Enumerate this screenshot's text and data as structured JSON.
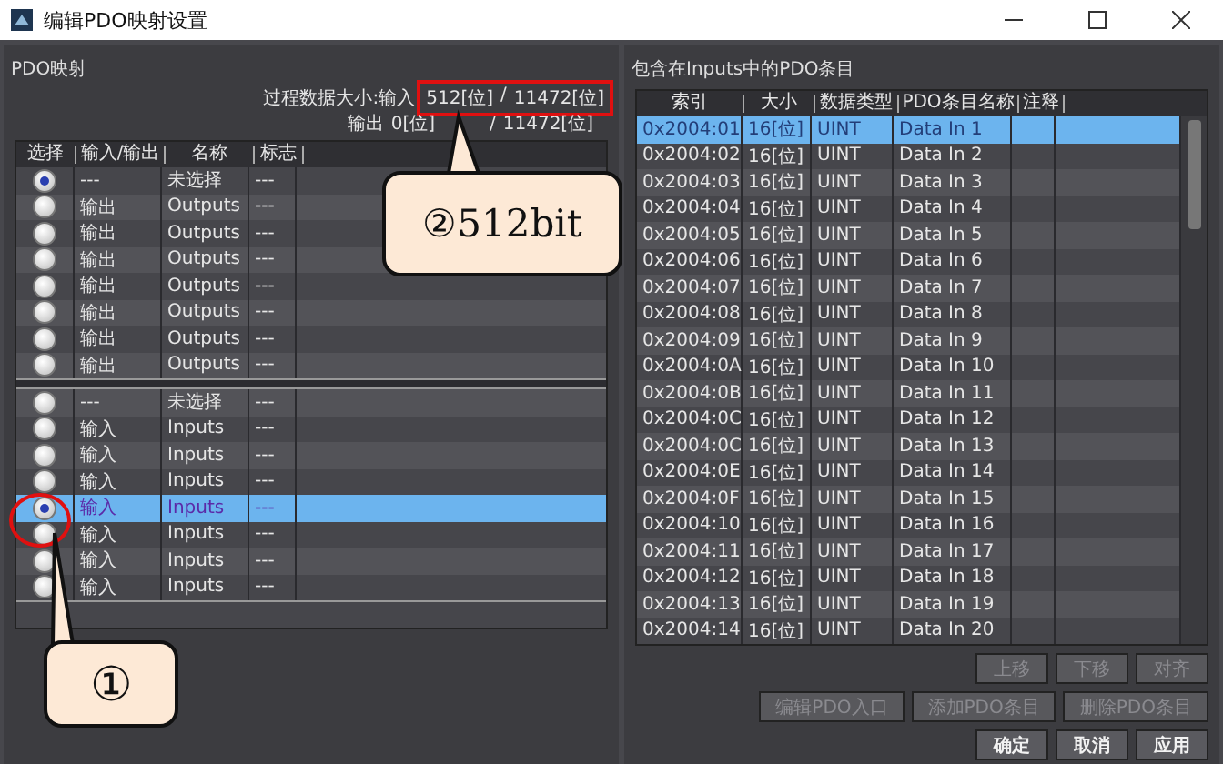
{
  "window": {
    "title": "编辑PDO映射设置"
  },
  "pdo_mapping": {
    "label": "PDO映射",
    "summary": {
      "input_label": "过程数据大小:输入",
      "input_used": "512[位]",
      "input_total": "11472[位]",
      "output_label": "输出",
      "output_used": "0[位]",
      "output_total": "11472[位]",
      "separator": "/"
    },
    "columns": [
      "选择",
      "输入/输出",
      "名称",
      "标志"
    ],
    "output_rows": [
      {
        "io": "---",
        "name": "未选择",
        "flag": "---",
        "selected": true,
        "highlighted": false
      },
      {
        "io": "输出",
        "name": "Outputs",
        "flag": "---",
        "selected": false,
        "highlighted": false
      },
      {
        "io": "输出",
        "name": "Outputs",
        "flag": "---",
        "selected": false,
        "highlighted": false
      },
      {
        "io": "输出",
        "name": "Outputs",
        "flag": "---",
        "selected": false,
        "highlighted": false
      },
      {
        "io": "输出",
        "name": "Outputs",
        "flag": "---",
        "selected": false,
        "highlighted": false
      },
      {
        "io": "输出",
        "name": "Outputs",
        "flag": "---",
        "selected": false,
        "highlighted": false
      },
      {
        "io": "输出",
        "name": "Outputs",
        "flag": "---",
        "selected": false,
        "highlighted": false
      },
      {
        "io": "输出",
        "name": "Outputs",
        "flag": "---",
        "selected": false,
        "highlighted": false
      }
    ],
    "input_rows": [
      {
        "io": "---",
        "name": "未选择",
        "flag": "---",
        "selected": false,
        "highlighted": false
      },
      {
        "io": "输入",
        "name": "Inputs",
        "flag": "---",
        "selected": false,
        "highlighted": false
      },
      {
        "io": "输入",
        "name": "Inputs",
        "flag": "---",
        "selected": false,
        "highlighted": false
      },
      {
        "io": "输入",
        "name": "Inputs",
        "flag": "---",
        "selected": false,
        "highlighted": false
      },
      {
        "io": "输入",
        "name": "Inputs",
        "flag": "---",
        "selected": true,
        "highlighted": true
      },
      {
        "io": "输入",
        "name": "Inputs",
        "flag": "---",
        "selected": false,
        "highlighted": false
      },
      {
        "io": "输入",
        "name": "Inputs",
        "flag": "---",
        "selected": false,
        "highlighted": false
      },
      {
        "io": "输入",
        "name": "Inputs",
        "flag": "---",
        "selected": false,
        "highlighted": false
      }
    ]
  },
  "entries": {
    "label": "包含在Inputs中的PDO条目",
    "columns": [
      "索引",
      "大小",
      "数据类型",
      "PDO条目名称",
      "注释"
    ],
    "rows": [
      {
        "index": "0x2004:01",
        "size": "16[位]",
        "type": "UINT",
        "name": "Data In 1",
        "selected": true
      },
      {
        "index": "0x2004:02",
        "size": "16[位]",
        "type": "UINT",
        "name": "Data In 2",
        "selected": false
      },
      {
        "index": "0x2004:03",
        "size": "16[位]",
        "type": "UINT",
        "name": "Data In 3",
        "selected": false
      },
      {
        "index": "0x2004:04",
        "size": "16[位]",
        "type": "UINT",
        "name": "Data In 4",
        "selected": false
      },
      {
        "index": "0x2004:05",
        "size": "16[位]",
        "type": "UINT",
        "name": "Data In 5",
        "selected": false
      },
      {
        "index": "0x2004:06",
        "size": "16[位]",
        "type": "UINT",
        "name": "Data In 6",
        "selected": false
      },
      {
        "index": "0x2004:07",
        "size": "16[位]",
        "type": "UINT",
        "name": "Data In 7",
        "selected": false
      },
      {
        "index": "0x2004:08",
        "size": "16[位]",
        "type": "UINT",
        "name": "Data In 8",
        "selected": false
      },
      {
        "index": "0x2004:09",
        "size": "16[位]",
        "type": "UINT",
        "name": "Data In 9",
        "selected": false
      },
      {
        "index": "0x2004:0A",
        "size": "16[位]",
        "type": "UINT",
        "name": "Data In 10",
        "selected": false
      },
      {
        "index": "0x2004:0B",
        "size": "16[位]",
        "type": "UINT",
        "name": "Data In 11",
        "selected": false
      },
      {
        "index": "0x2004:0C",
        "size": "16[位]",
        "type": "UINT",
        "name": "Data In 12",
        "selected": false
      },
      {
        "index": "0x2004:0C",
        "size": "16[位]",
        "type": "UINT",
        "name": "Data In 13",
        "selected": false
      },
      {
        "index": "0x2004:0E",
        "size": "16[位]",
        "type": "UINT",
        "name": "Data In 14",
        "selected": false
      },
      {
        "index": "0x2004:0F",
        "size": "16[位]",
        "type": "UINT",
        "name": "Data In 15",
        "selected": false
      },
      {
        "index": "0x2004:10",
        "size": "16[位]",
        "type": "UINT",
        "name": "Data In 16",
        "selected": false
      },
      {
        "index": "0x2004:11",
        "size": "16[位]",
        "type": "UINT",
        "name": "Data In 17",
        "selected": false
      },
      {
        "index": "0x2004:12",
        "size": "16[位]",
        "type": "UINT",
        "name": "Data In 18",
        "selected": false
      },
      {
        "index": "0x2004:13",
        "size": "16[位]",
        "type": "UINT",
        "name": "Data In 19",
        "selected": false
      },
      {
        "index": "0x2004:14",
        "size": "16[位]",
        "type": "UINT",
        "name": "Data In 20",
        "selected": false
      }
    ]
  },
  "button_rows": [
    [
      {
        "label": "上移",
        "disabled": true
      },
      {
        "label": "下移",
        "disabled": true
      },
      {
        "label": "对齐",
        "disabled": true
      }
    ],
    [
      {
        "label": "编辑PDO入口",
        "disabled": true
      },
      {
        "label": "添加PDO条目",
        "disabled": true
      },
      {
        "label": "删除PDO条目",
        "disabled": true
      }
    ],
    [
      {
        "label": "确定",
        "disabled": false
      },
      {
        "label": "取消",
        "disabled": false
      },
      {
        "label": "应用",
        "disabled": false
      }
    ]
  ],
  "callouts": [
    {
      "text": "②512bit"
    },
    {
      "text": "①"
    }
  ]
}
